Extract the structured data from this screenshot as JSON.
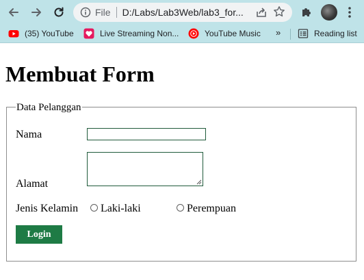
{
  "browser": {
    "omnibox": {
      "scheme_label": "File",
      "url": "D:/Labs/Lab3Web/lab3_for..."
    },
    "bookmarks": [
      {
        "label": "(35) YouTube",
        "icon": "youtube-icon"
      },
      {
        "label": "Live Streaming Non...",
        "icon": "streaming-heart-icon"
      },
      {
        "label": "YouTube Music",
        "icon": "youtube-music-icon"
      }
    ],
    "more_label": "»",
    "reading_list_label": "Reading list"
  },
  "page": {
    "heading": "Membuat Form",
    "fieldset_legend": "Data Pelanggan",
    "labels": {
      "nama": "Nama",
      "alamat": "Alamat",
      "jenis_kelamin": "Jenis Kelamin"
    },
    "inputs": {
      "nama_value": "",
      "alamat_value": ""
    },
    "radio_options": [
      "Laki-laki",
      "Perempuan"
    ],
    "login_button": "Login"
  },
  "colors": {
    "chrome_background": "#bfe3e8",
    "button_background": "#1e7b45",
    "input_border": "#1f5a3a"
  }
}
